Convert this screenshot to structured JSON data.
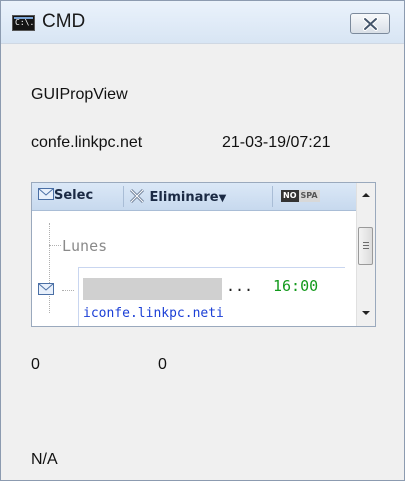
{
  "window": {
    "title": "CMD",
    "icon_text": "C:\\.",
    "icon": "console-icon",
    "close_icon": "close-icon"
  },
  "info": {
    "prop_label": "GUIPropView",
    "host": "confe.linkpc.net",
    "timestamp": "21-03-19/07:21"
  },
  "embedded": {
    "toolbar": {
      "select_label": "Selec",
      "delete_label": "Eliminare",
      "no_label": "NO",
      "spam_label": "SPA"
    },
    "day_label": "Lunes",
    "message": {
      "ellipsis": "...",
      "time": "16:00",
      "sender": "iconfe.linkpc.neti"
    }
  },
  "values": {
    "left": "0",
    "right": "0",
    "status": "N/A"
  },
  "colors": {
    "time": "#139a1c",
    "sender": "#1b3fd6",
    "toolbar_bg": "#c7d9ee"
  }
}
